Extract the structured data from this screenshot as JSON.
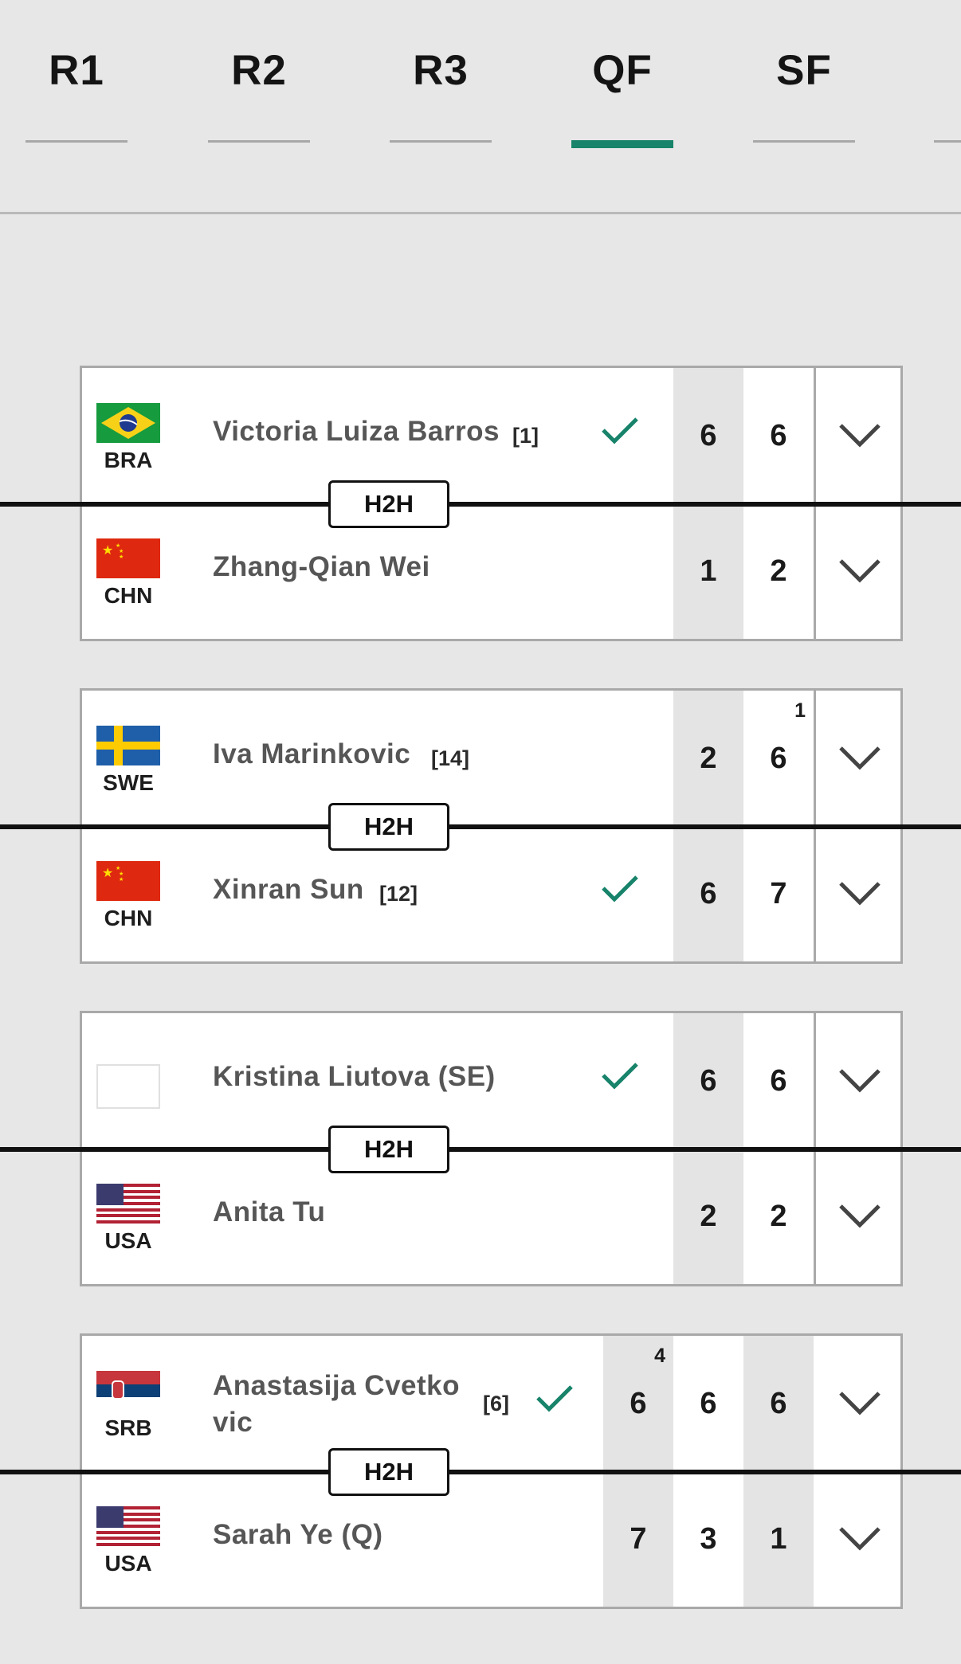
{
  "tabs": [
    {
      "label": "R1",
      "active": false
    },
    {
      "label": "R2",
      "active": false
    },
    {
      "label": "R3",
      "active": false
    },
    {
      "label": "QF",
      "active": true
    },
    {
      "label": "SF",
      "active": false
    }
  ],
  "h2h_label": "H2H",
  "accent_color": "#17836a",
  "matches": [
    {
      "players": [
        {
          "name": "Victoria Luiza Barros",
          "seed": "[1]",
          "country": "BRA",
          "flag": "brazil-flag",
          "winner": true,
          "scores": [
            "6",
            "6"
          ],
          "tiebreaks": [
            "",
            ""
          ]
        },
        {
          "name": "Zhang-Qian Wei",
          "seed": "",
          "country": "CHN",
          "flag": "china-flag",
          "winner": false,
          "scores": [
            "1",
            "2"
          ],
          "tiebreaks": [
            "",
            ""
          ]
        }
      ]
    },
    {
      "players": [
        {
          "name": "Iva Marinkovic",
          "seed": "[14]",
          "country": "SWE",
          "flag": "sweden-flag",
          "winner": false,
          "scores": [
            "2",
            "6"
          ],
          "tiebreaks": [
            "",
            "1"
          ]
        },
        {
          "name": "Xinran Sun",
          "seed": "[12]",
          "country": "CHN",
          "flag": "china-flag",
          "winner": true,
          "scores": [
            "6",
            "7"
          ],
          "tiebreaks": [
            "",
            ""
          ]
        }
      ]
    },
    {
      "players": [
        {
          "name": "Kristina Liutova (SE)",
          "seed": "",
          "country": "",
          "flag": "blank-flag",
          "winner": true,
          "scores": [
            "6",
            "6"
          ],
          "tiebreaks": [
            "",
            ""
          ]
        },
        {
          "name": "Anita Tu",
          "seed": "",
          "country": "USA",
          "flag": "usa-flag",
          "winner": false,
          "scores": [
            "2",
            "2"
          ],
          "tiebreaks": [
            "",
            ""
          ]
        }
      ]
    },
    {
      "players": [
        {
          "name": "Anastasija Cvetkovic",
          "name_line1": "Anastasija Cvetko",
          "name_line2": "vic",
          "seed": "[6]",
          "country": "SRB",
          "flag": "serbia-flag",
          "winner": true,
          "scores": [
            "6",
            "6",
            "6"
          ],
          "tiebreaks": [
            "4",
            "",
            ""
          ]
        },
        {
          "name": "Sarah Ye (Q)",
          "seed": "",
          "country": "USA",
          "flag": "usa-flag",
          "winner": false,
          "scores": [
            "7",
            "3",
            "1"
          ],
          "tiebreaks": [
            "",
            "",
            ""
          ]
        }
      ]
    }
  ]
}
